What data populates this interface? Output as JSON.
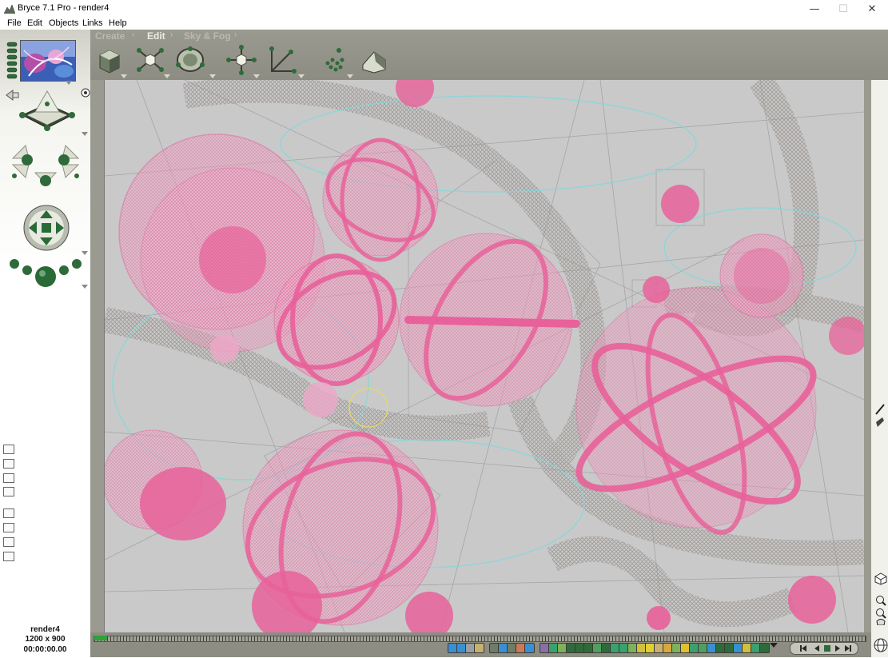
{
  "window": {
    "title": "Bryce 7.1  Pro - render4",
    "controls": [
      "—",
      "☐",
      "✕"
    ]
  },
  "menu": [
    "File",
    "Edit",
    "Objects",
    "Links",
    "Help"
  ],
  "palette_tabs": [
    {
      "label": "Create",
      "active": false
    },
    {
      "label": "Edit",
      "active": true
    },
    {
      "label": "Sky & Fog",
      "active": false
    }
  ],
  "toolbar_icons": [
    "material-lab-icon",
    "resize-icon",
    "rotate-icon",
    "reposition-icon",
    "align-icon",
    "randomize-icon",
    "terrain-editor-icon"
  ],
  "status": {
    "document_name": "render4",
    "resolution": "1200 x 900",
    "timecode": "00:00:00.00"
  },
  "colors": {
    "chrome": "#8d8d84",
    "viewport": "#c9c9c9",
    "wireframe_accent": "#e8619a"
  }
}
